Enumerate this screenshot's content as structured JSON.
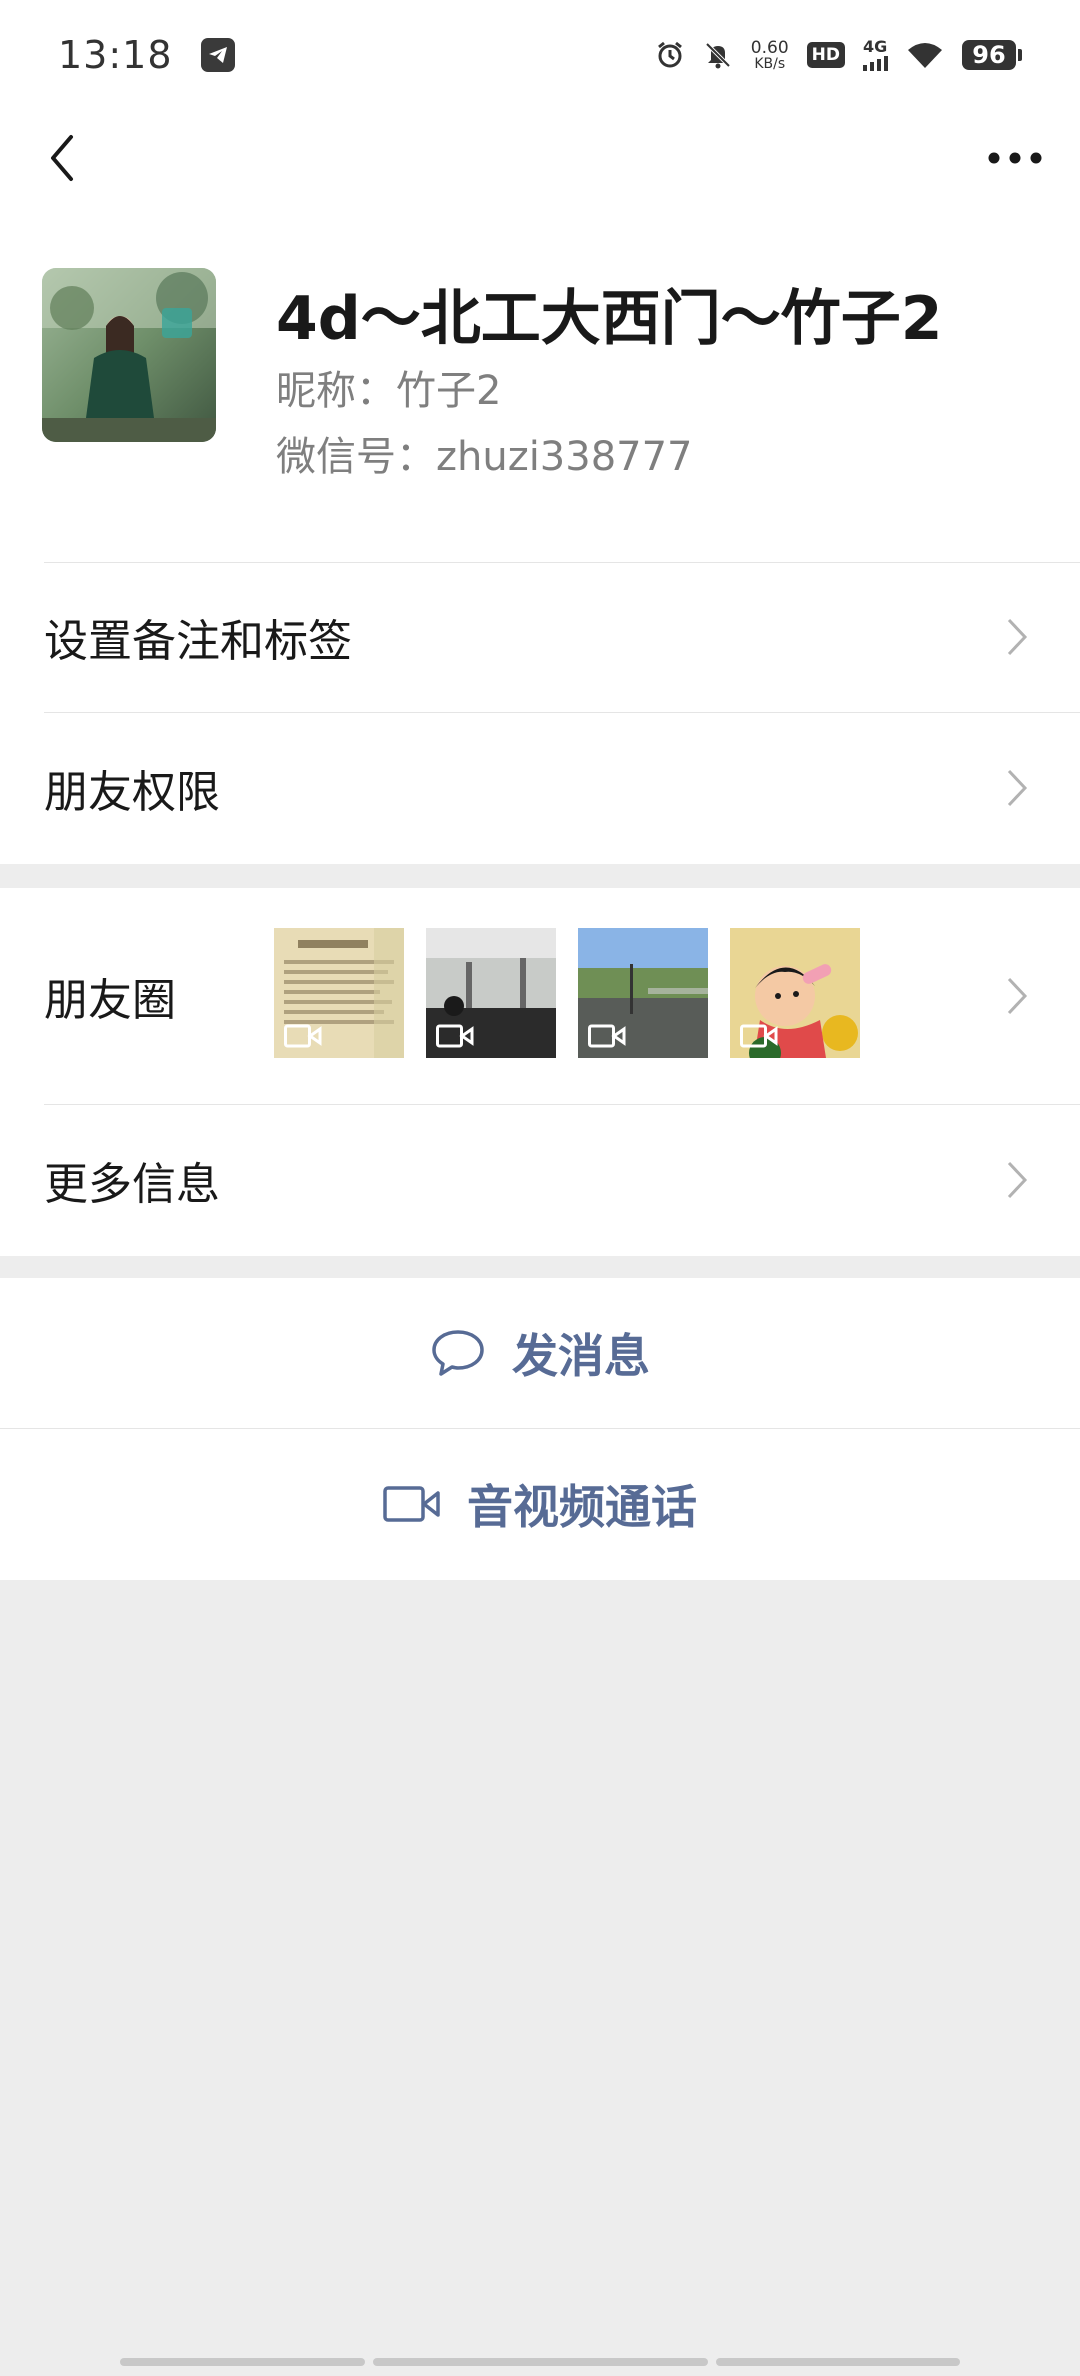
{
  "status_bar": {
    "time": "13:18",
    "net_speed_value": "0.60",
    "net_speed_unit": "KB/s",
    "hd_label": "HD",
    "network_type": "4G",
    "battery_level": "96",
    "icons": [
      "telegram-icon",
      "alarm-icon",
      "mute-bell-icon",
      "signal-icon",
      "wifi-icon",
      "battery-icon"
    ]
  },
  "nav": {
    "back_icon": "chevron-left-icon",
    "more_icon": "ellipsis-icon"
  },
  "profile": {
    "display_name": "4d～北工大西门～竹子2",
    "nickname": "昵称：竹子2",
    "wechat_id": "微信号：zhuzi338777"
  },
  "rows": {
    "remark_tags": "设置备注和标签",
    "friend_permissions": "朋友权限",
    "moments": "朋友圈",
    "more_info": "更多信息"
  },
  "moments_thumbs": [
    {
      "kind": "text-page",
      "video": true
    },
    {
      "kind": "station",
      "video": true
    },
    {
      "kind": "railway",
      "video": true
    },
    {
      "kind": "cartoon",
      "video": true
    }
  ],
  "actions": {
    "send_message": "发消息",
    "av_call": "音视频通话"
  },
  "colors": {
    "link_blue": "#576b95",
    "background": "#ededed",
    "card": "#ffffff"
  }
}
